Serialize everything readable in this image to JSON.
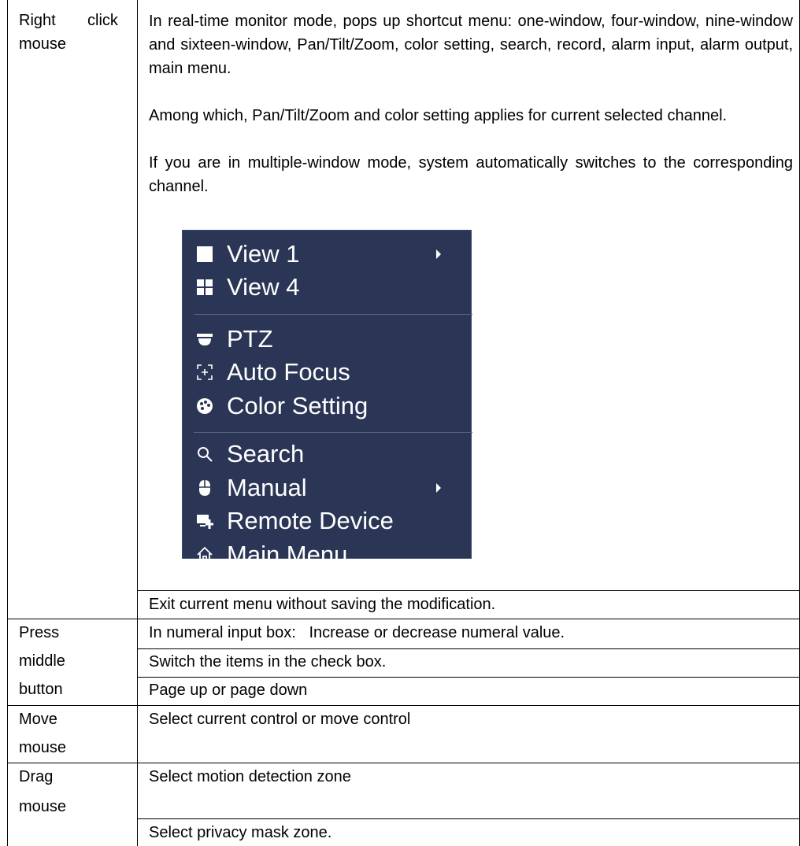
{
  "rows": {
    "right_click": {
      "label_line1_a": "Right",
      "label_line1_b": "click",
      "label_line2": "mouse",
      "para1": "In real-time monitor mode, pops up shortcut menu: one-window, four-window, nine-window and sixteen-window, Pan/Tilt/Zoom, color setting, search, record, alarm input, alarm output, main menu.",
      "para2": "Among which, Pan/Tilt/Zoom and color setting applies for current selected channel.",
      "para3": "If you are in multiple-window mode, system automatically switches to the corresponding channel.",
      "exit_text": "Exit current menu without saving the modification."
    },
    "press_middle": {
      "label_lines": [
        "Press",
        "middle",
        "button"
      ],
      "items": [
        "In numeral input box:   Increase or decrease numeral value.",
        "Switch the items in the check box.",
        "Page up or page down"
      ]
    },
    "move_mouse": {
      "label_lines": [
        "Move",
        "mouse"
      ],
      "text": "Select current control or move control"
    },
    "drag_mouse": {
      "label_lines": [
        "Drag",
        "mouse"
      ],
      "items": [
        "Select motion detection zone",
        "Select privacy mask zone."
      ]
    }
  },
  "menu": {
    "colors": {
      "background": "#2b3656",
      "text": "#ffffff",
      "separator": "#56627f"
    },
    "items": [
      {
        "label": "View 1",
        "icon": "single-window-icon",
        "submenu": true
      },
      {
        "label": "View 4",
        "icon": "quad-window-icon",
        "submenu": false
      },
      {
        "label": "PTZ",
        "icon": "ptz-camera-icon",
        "submenu": false
      },
      {
        "label": "Auto Focus",
        "icon": "focus-icon",
        "submenu": false
      },
      {
        "label": "Color Setting",
        "icon": "palette-icon",
        "submenu": false
      },
      {
        "label": "Search",
        "icon": "search-icon",
        "submenu": false
      },
      {
        "label": "Manual",
        "icon": "mouse-icon",
        "submenu": true
      },
      {
        "label": "Remote Device",
        "icon": "remote-device-icon",
        "submenu": false
      },
      {
        "label": "Main Menu",
        "icon": "home-icon",
        "submenu": false
      }
    ]
  }
}
